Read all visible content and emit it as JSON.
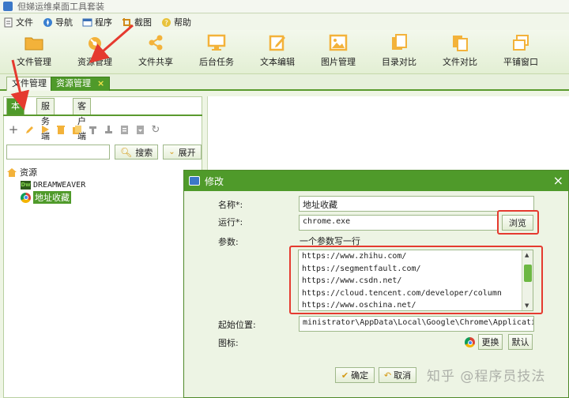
{
  "app": {
    "title": "但娣运维桌面工具套装"
  },
  "menu": [
    {
      "label": "文件",
      "icon": "file-icon"
    },
    {
      "label": "导航",
      "icon": "compass-icon"
    },
    {
      "label": "程序",
      "icon": "window-icon"
    },
    {
      "label": "截图",
      "icon": "crop-icon"
    },
    {
      "label": "帮助",
      "icon": "help-icon"
    }
  ],
  "toolbar": [
    {
      "label": "文件管理",
      "icon": "folder-icon"
    },
    {
      "label": "资源管理",
      "icon": "satellite-icon"
    },
    {
      "label": "文件共享",
      "icon": "share-icon"
    },
    {
      "label": "后台任务",
      "icon": "monitor-icon"
    },
    {
      "label": "文本编辑",
      "icon": "edit-icon"
    },
    {
      "label": "图片管理",
      "icon": "image-icon"
    },
    {
      "label": "目录对比",
      "icon": "compare-folder-icon"
    },
    {
      "label": "文件对比",
      "icon": "compare-file-icon"
    },
    {
      "label": "平铺窗口",
      "icon": "tile-icon"
    }
  ],
  "doc_tabs": [
    {
      "label": "文件管理"
    },
    {
      "label": "资源管理",
      "close": "×"
    }
  ],
  "sub_tabs": [
    "本地",
    "服务端",
    "客户端"
  ],
  "search": {
    "placeholder": "",
    "search_label": "搜索",
    "expand_label": "展开"
  },
  "tree": {
    "root": "资源",
    "children": [
      "DREAMWEAVER",
      "地址收藏"
    ]
  },
  "dialog": {
    "title": "修改",
    "close": "×",
    "labels": {
      "name": "名称*:",
      "run": "运行*:",
      "params": "参数:",
      "start_dir": "起始位置:",
      "icon": "图标:"
    },
    "name_value": "地址收藏",
    "run_value": "chrome.exe",
    "browse_label": "浏览",
    "params_hint": "一个参数写一行",
    "params_lines": [
      "https://www.zhihu.com/",
      "https://segmentfault.com/",
      "https://www.csdn.net/",
      "https://cloud.tencent.com/developer/column",
      "https://www.oschina.net/"
    ],
    "start_dir_value": "ministrator\\AppData\\Local\\Google\\Chrome\\Application",
    "change_label": "更换",
    "default_label": "默认",
    "ok_label": "确定",
    "cancel_label": "取消"
  },
  "watermark": "知乎 @程序员技法",
  "colors": {
    "accent": "#4f9a2a",
    "annotation": "#e53a2f",
    "panel_bg": "#eef5e4"
  }
}
